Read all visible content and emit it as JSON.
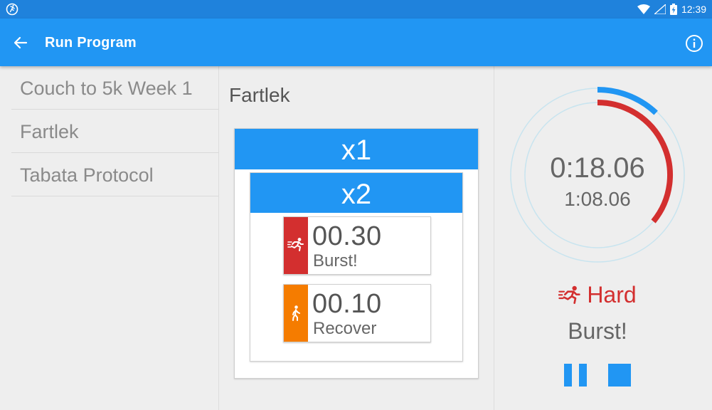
{
  "status_bar": {
    "time": "12:39",
    "icons": [
      "app-running-icon",
      "wifi-icon",
      "signal-icon",
      "battery-charging-icon"
    ]
  },
  "app_bar": {
    "title": "Run Program",
    "back_icon": "arrow-back-icon",
    "info_icon": "info-icon"
  },
  "programs": [
    {
      "label": "Couch to 5k Week 1"
    },
    {
      "label": "Fartlek"
    },
    {
      "label": "Tabata Protocol"
    }
  ],
  "detail": {
    "title": "Fartlek",
    "outer_repeat": "x1",
    "inner_repeat": "x2",
    "steps": [
      {
        "time": "00.30",
        "label": "Burst!",
        "color": "#d32f2f",
        "icon": "sprint-icon"
      },
      {
        "time": "00.10",
        "label": "Recover",
        "color": "#f57c00",
        "icon": "walk-icon"
      }
    ]
  },
  "timer": {
    "elapsed": "0:18.06",
    "total": "1:08.06",
    "intensity": "Hard",
    "intensity_color": "#d32f2f",
    "step_label": "Burst!",
    "step_progress": 0.36,
    "total_progress": 0.12,
    "step_color": "#d32f2f",
    "total_color": "#2196f3"
  },
  "controls": {
    "pause_icon": "pause-icon",
    "stop_icon": "stop-icon",
    "color": "#2196f3"
  },
  "colors": {
    "primary": "#2196f3",
    "status_bar": "#1f82dc"
  }
}
